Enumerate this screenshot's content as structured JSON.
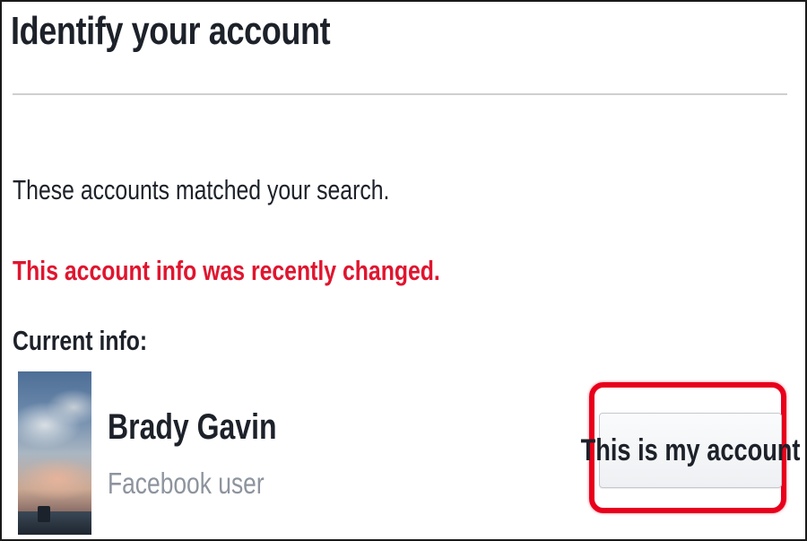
{
  "header": {
    "title": "Identify your account"
  },
  "main": {
    "description": "These accounts matched your search.",
    "warning": "This account info was recently changed.",
    "current_info_label": "Current info:",
    "account": {
      "name": "Brady Gavin",
      "subtitle": "Facebook user",
      "confirm_button_label": "This is my account"
    }
  },
  "colors": {
    "warning_text": "#e0152f",
    "highlight_outline": "#e8001c",
    "primary_text": "#1d2129",
    "secondary_text": "#8d949e"
  }
}
